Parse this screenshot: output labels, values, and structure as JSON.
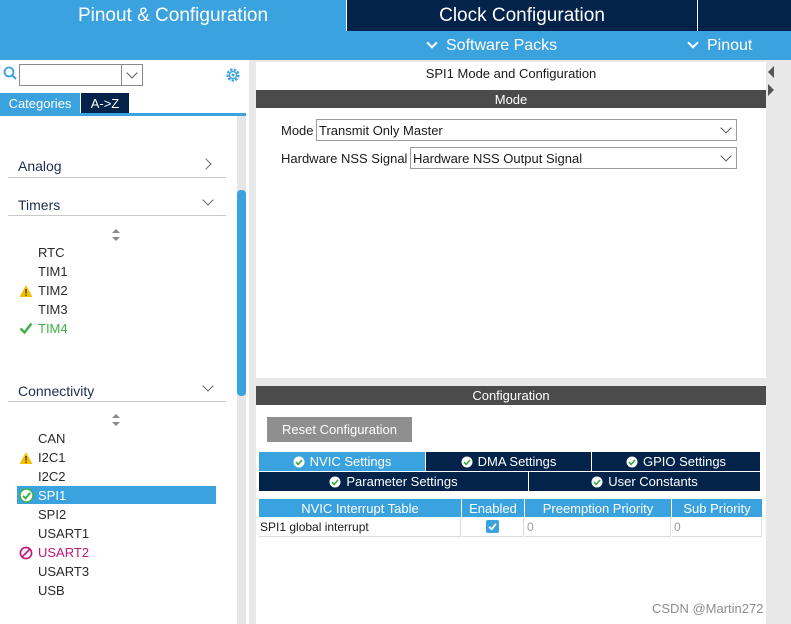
{
  "top_tabs": {
    "pinout": "Pinout & Configuration",
    "clock": "Clock Configuration"
  },
  "subbar": {
    "software_packs": "Software Packs",
    "pinout": "Pinout"
  },
  "sidebar": {
    "search_value": "",
    "categories_label": "Categories",
    "atoz_label": "A->Z",
    "categories": [
      {
        "label": "Analog",
        "state": "collapsed"
      },
      {
        "label": "Timers",
        "state": "expanded"
      },
      {
        "label": "Connectivity",
        "state": "expanded"
      }
    ],
    "timers_items": [
      {
        "label": "RTC",
        "status": "none"
      },
      {
        "label": "TIM1",
        "status": "none"
      },
      {
        "label": "TIM2",
        "status": "warning"
      },
      {
        "label": "TIM3",
        "status": "none"
      },
      {
        "label": "TIM4",
        "status": "ok"
      }
    ],
    "connectivity_items": [
      {
        "label": "CAN",
        "status": "none"
      },
      {
        "label": "I2C1",
        "status": "warning"
      },
      {
        "label": "I2C2",
        "status": "none"
      },
      {
        "label": "SPI1",
        "status": "ok-selected"
      },
      {
        "label": "SPI2",
        "status": "none"
      },
      {
        "label": "USART1",
        "status": "none"
      },
      {
        "label": "USART2",
        "status": "disabled"
      },
      {
        "label": "USART3",
        "status": "none"
      },
      {
        "label": "USB",
        "status": "none"
      }
    ]
  },
  "main": {
    "panel_title": "SPI1 Mode and Configuration",
    "mode_header": "Mode",
    "mode_label": "Mode",
    "mode_value": "Transmit Only Master",
    "nss_label": "Hardware NSS Signal",
    "nss_value": "Hardware NSS Output Signal",
    "config_header": "Configuration",
    "reset_button": "Reset Configuration",
    "tabs": [
      {
        "label": "NVIC Settings",
        "active": true
      },
      {
        "label": "DMA Settings",
        "active": false
      },
      {
        "label": "GPIO Settings",
        "active": false
      },
      {
        "label": "Parameter Settings",
        "active": false
      },
      {
        "label": "User Constants",
        "active": false
      }
    ],
    "table": {
      "columns": [
        "NVIC Interrupt Table",
        "Enabled",
        "Preemption Priority",
        "Sub Priority"
      ],
      "rows": [
        {
          "name": "SPI1 global interrupt",
          "enabled": true,
          "preemption": "0",
          "sub": "0"
        }
      ]
    }
  },
  "watermark": "CSDN @Martin272",
  "colors": {
    "accent_blue": "#3aa3df",
    "navy": "#03234b",
    "ok_green": "#3cb043",
    "warn_yellow": "#f2c200",
    "disabled_magenta": "#c0167a"
  }
}
